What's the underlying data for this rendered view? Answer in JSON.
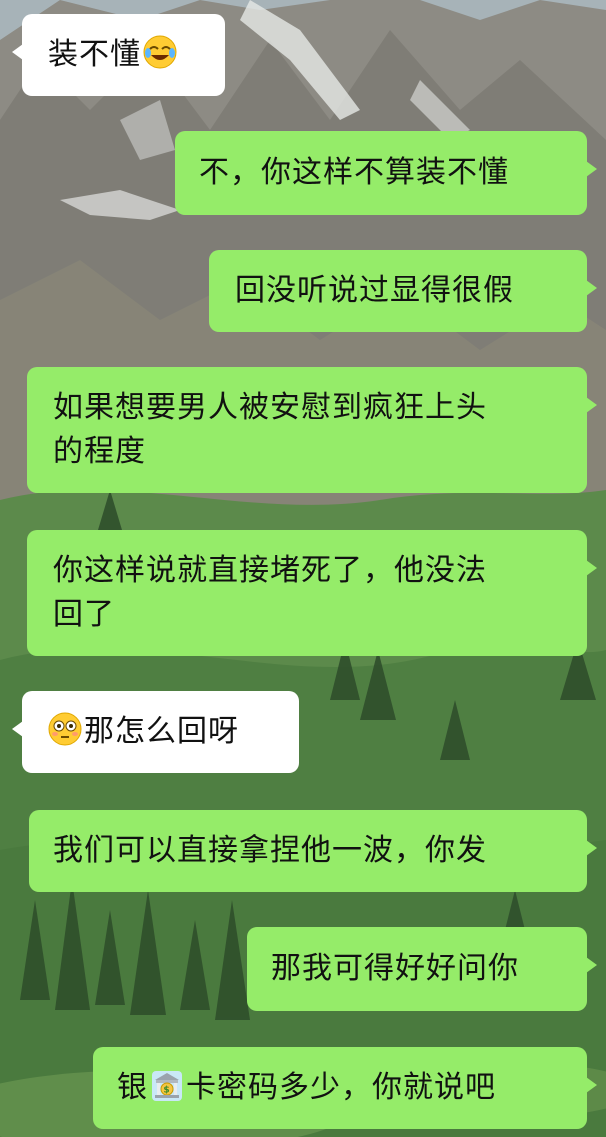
{
  "chat": {
    "messages": [
      {
        "side": "left",
        "text": "装不懂",
        "emoji": "face-with-tears-of-joy-icon",
        "emoji_position": "after"
      },
      {
        "side": "right",
        "text": "不，你这样不算装不懂"
      },
      {
        "side": "right",
        "text": "回没听说过显得很假"
      },
      {
        "side": "right",
        "line1": "如果想要男人被安慰到疯狂上头",
        "line2": "的程度"
      },
      {
        "side": "right",
        "line1": "你这样说就直接堵死了，他没法",
        "line2": "回了"
      },
      {
        "side": "left",
        "text": "那怎么回呀",
        "emoji": "flushed-face-icon",
        "emoji_position": "before"
      },
      {
        "side": "right",
        "text": "我们可以直接拿捏他一波，你发"
      },
      {
        "side": "right",
        "text": "那我可得好好问你"
      },
      {
        "side": "right",
        "before": "银",
        "emoji": "bank-icon",
        "after": "卡密码多少，你就说吧"
      }
    ]
  },
  "colors": {
    "sent_bubble": "#95ec69",
    "received_bubble": "#ffffff",
    "text": "#111111"
  }
}
